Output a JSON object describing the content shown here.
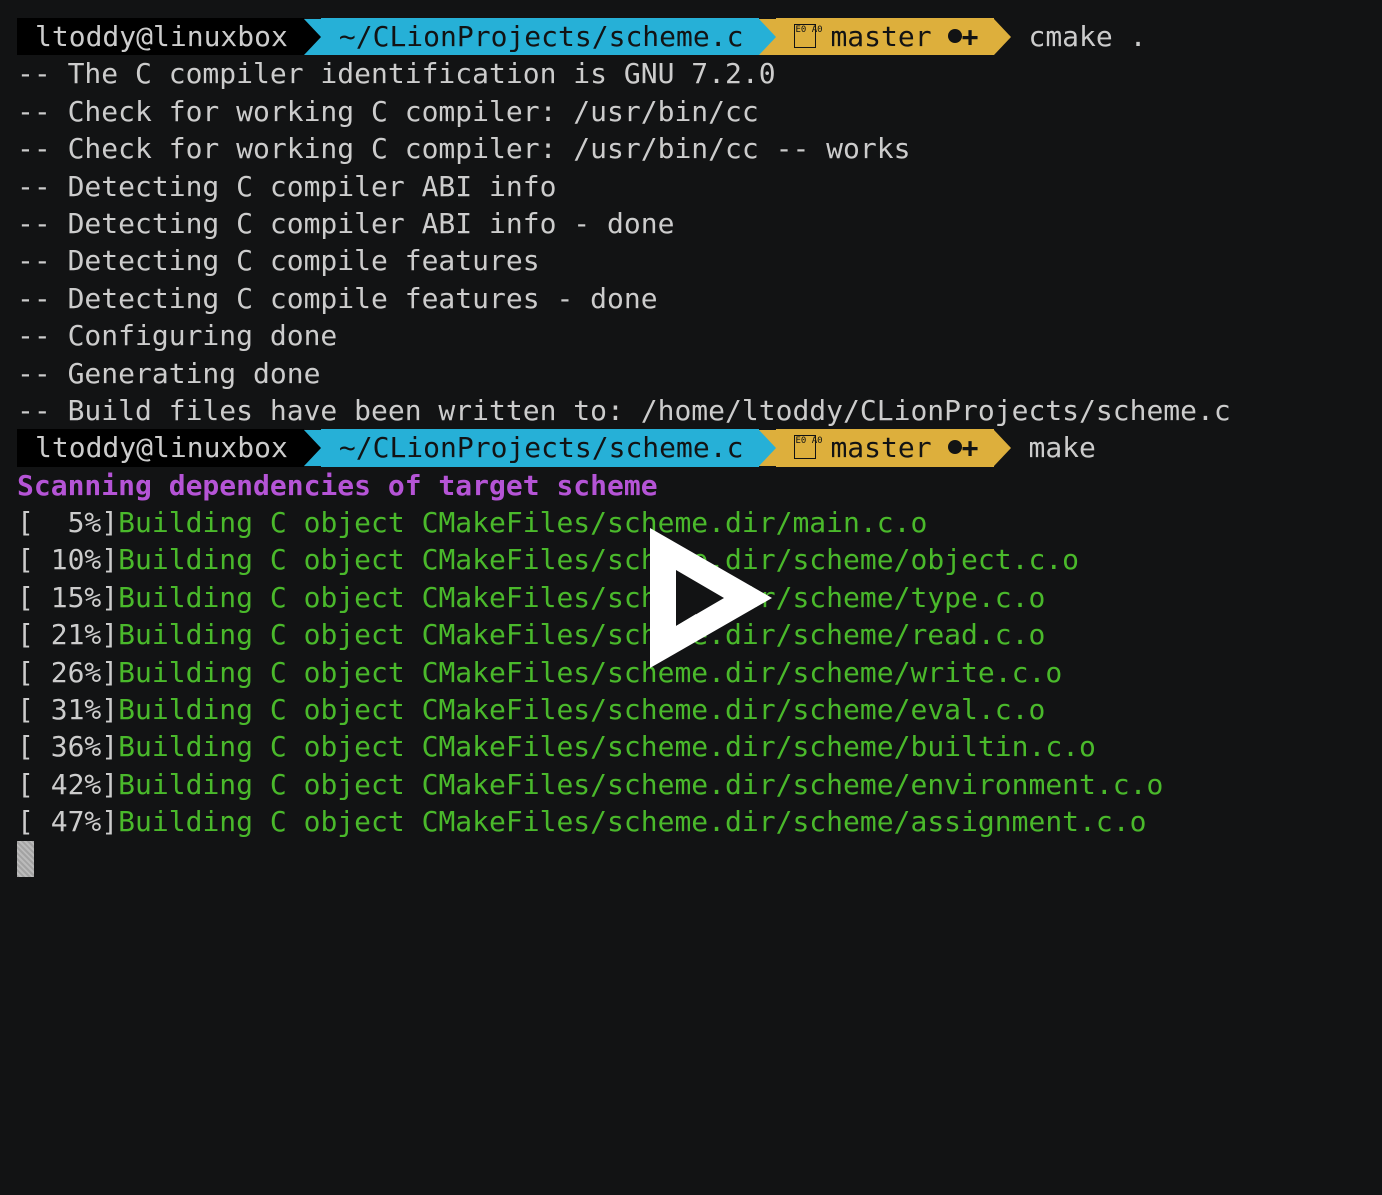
{
  "prompt": {
    "user": "ltoddy@linuxbox",
    "path": "~/CLionProjects/scheme.c",
    "branch": "master",
    "branch_icon_text": "E0 A0",
    "git_status": "+"
  },
  "commands": {
    "first": "cmake .",
    "second": "make"
  },
  "cmake_output": [
    "-- The C compiler identification is GNU 7.2.0",
    "-- Check for working C compiler: /usr/bin/cc",
    "-- Check for working C compiler: /usr/bin/cc -- works",
    "-- Detecting C compiler ABI info",
    "-- Detecting C compiler ABI info - done",
    "-- Detecting C compile features",
    "-- Detecting C compile features - done",
    "-- Configuring done",
    "-- Generating done",
    "-- Build files have been written to: /home/ltoddy/CLionProjects/scheme.c"
  ],
  "make_output": {
    "scanning": "Scanning dependencies of target scheme",
    "build_lines": [
      {
        "pct": "[  5%]",
        "text": "Building C object CMakeFiles/scheme.dir/main.c.o"
      },
      {
        "pct": "[ 10%]",
        "text": "Building C object CMakeFiles/scheme.dir/scheme/object.c.o"
      },
      {
        "pct": "[ 15%]",
        "text": "Building C object CMakeFiles/scheme.dir/scheme/type.c.o"
      },
      {
        "pct": "[ 21%]",
        "text": "Building C object CMakeFiles/scheme.dir/scheme/read.c.o"
      },
      {
        "pct": "[ 26%]",
        "text": "Building C object CMakeFiles/scheme.dir/scheme/write.c.o"
      },
      {
        "pct": "[ 31%]",
        "text": "Building C object CMakeFiles/scheme.dir/scheme/eval.c.o"
      },
      {
        "pct": "[ 36%]",
        "text": "Building C object CMakeFiles/scheme.dir/scheme/builtin.c.o"
      },
      {
        "pct": "[ 42%]",
        "text": "Building C object CMakeFiles/scheme.dir/scheme/environment.c.o"
      },
      {
        "pct": "[ 47%]",
        "text": "Building C object CMakeFiles/scheme.dir/scheme/assignment.c.o"
      }
    ]
  },
  "colors": {
    "background": "#121314",
    "text": "#cccccc",
    "user_segment": "#000000",
    "path_segment": "#26b0d7",
    "git_segment": "#ddaf3c",
    "build_green": "#4ab92b",
    "scan_magenta": "#b554d6"
  },
  "overlay": {
    "icon": "asciinema-play-icon"
  }
}
